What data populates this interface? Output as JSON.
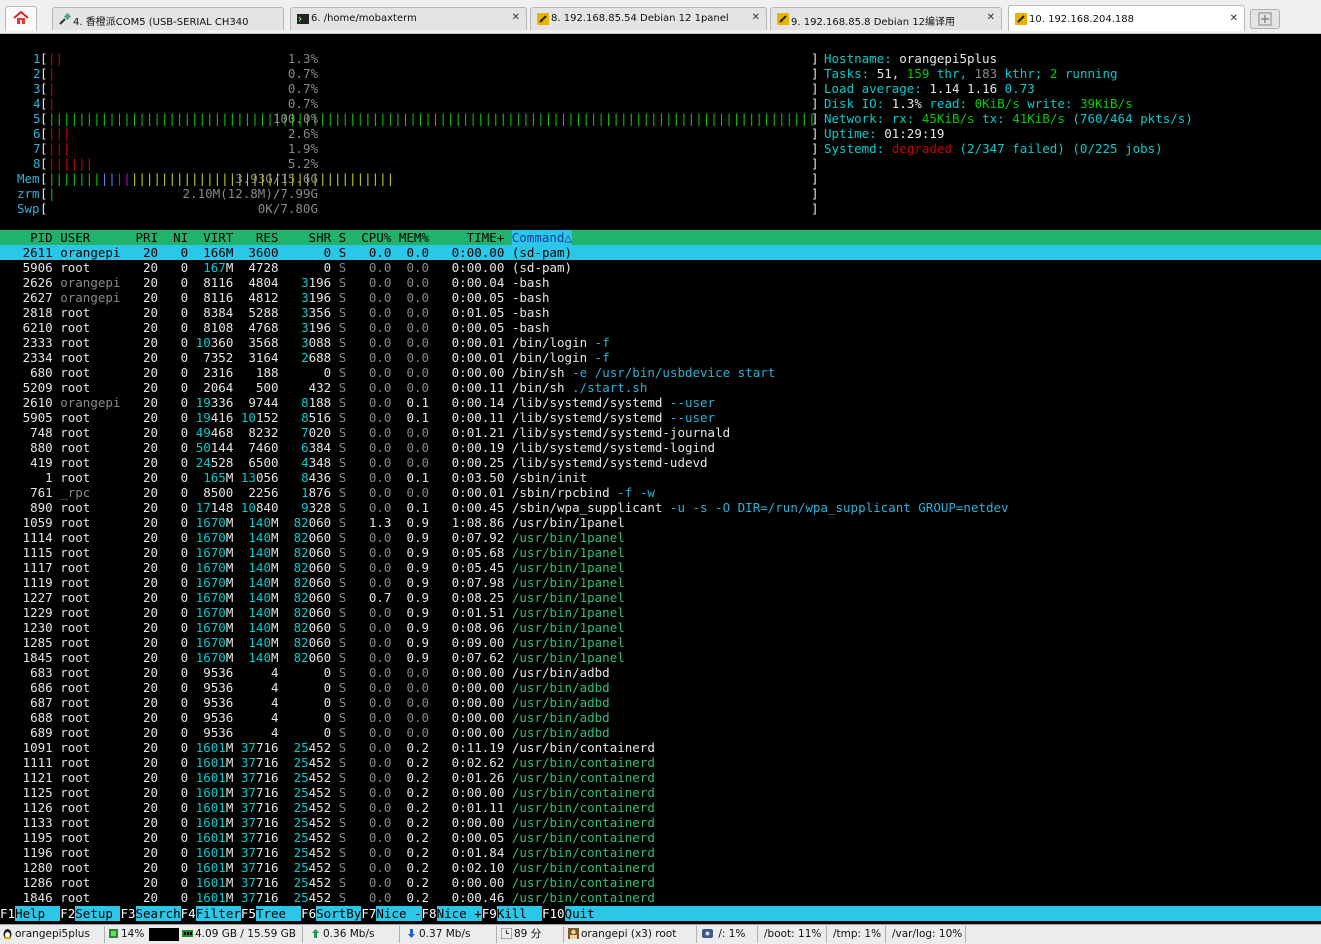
{
  "tabs": [
    {
      "label": "4. 香橙派COM5  (USB-SERIAL CH340",
      "close": "✕"
    },
    {
      "label": "6. /home/mobaxterm",
      "close": "✕"
    },
    {
      "label": "8. 192.168.85.54 Debian 12 1panel",
      "close": "✕"
    },
    {
      "label": "9. 192.168.85.8 Debian 12编译用",
      "close": "✕"
    },
    {
      "label": "10. 192.168.204.188",
      "close": "✕"
    }
  ],
  "cpu_meters": [
    {
      "label": "1",
      "bar": "||",
      "pct": "1.3%"
    },
    {
      "label": "2",
      "bar": "|",
      "pct": "0.7%"
    },
    {
      "label": "3",
      "bar": "|",
      "pct": "0.7%"
    },
    {
      "label": "4",
      "bar": "|",
      "pct": "0.7%"
    },
    {
      "label": "5",
      "bar": "||||||||||||||||||||||||||||||||||||||||||||||||||||||||||||||||||||||||||||||||||||||||||||||||||||||",
      "pct": "100.0%"
    },
    {
      "label": "6",
      "bar": "|||",
      "pct": "2.6%"
    },
    {
      "label": "7",
      "bar": "|||",
      "pct": "1.9%"
    },
    {
      "label": "8",
      "bar": "||||||",
      "pct": "5.2%"
    }
  ],
  "mem_meters": [
    {
      "label": "Mem",
      "value": "3.93G/15.6G"
    },
    {
      "label": "zrm",
      "value": "2.10M(12.8M)/7.99G"
    },
    {
      "label": "Swp",
      "value": "0K/7.80G"
    }
  ],
  "sysinfo": {
    "hostname_label": "Hostname:",
    "hostname": "orangepi5plus",
    "tasks_label": "Tasks:",
    "tasks": "51,",
    "thr": "159",
    "thr_label": "thr,",
    "kthr": "183",
    "kthr_label": "kthr;",
    "running": "2",
    "running_label": "running",
    "load_label": "Load average:",
    "load1": "1.14",
    "load5": "1.16",
    "load15": "0.73",
    "disk_label": "Disk IO:",
    "disk_pct": "1.3%",
    "disk_read_label": "read:",
    "disk_read": "0KiB/s",
    "disk_write_label": "write:",
    "disk_write": "39KiB/s",
    "net_label": "Network:",
    "net_rx_label": "rx:",
    "net_rx": "45KiB/s",
    "net_tx_label": "tx:",
    "net_tx": "41KiB/s",
    "net_pkts": "(760/464 pkts/s)",
    "uptime_label": "Uptime:",
    "uptime": "01:29:19",
    "systemd_label": "Systemd:",
    "systemd_state": "degraded",
    "systemd_failed": "(2/347 failed)",
    "systemd_jobs": "(0/225 jobs)"
  },
  "columns": [
    "PID",
    "USER",
    "PRI",
    "NI",
    "VIRT",
    "RES",
    "SHR",
    "S",
    "CPU%",
    "MEM%",
    "TIME+",
    "Command△"
  ],
  "processes": [
    {
      "pid": "2611",
      "user": "orangepi",
      "pri": "20",
      "ni": "0",
      "virt": "166M",
      "res": "3600",
      "shr": "0",
      "s": "S",
      "cpu": "0.0",
      "mem": "0.0",
      "time": "0:00.00",
      "cmd": "(sd-pam)",
      "args": ""
    },
    {
      "pid": "5906",
      "user": "root",
      "pri": "20",
      "ni": "0",
      "virt": "167M",
      "res": "4728",
      "shr": "0",
      "s": "S",
      "cpu": "0.0",
      "mem": "0.0",
      "time": "0:00.00",
      "cmd": "(sd-pam)",
      "args": ""
    },
    {
      "pid": "2626",
      "user": "orangepi",
      "pri": "20",
      "ni": "0",
      "virt": "8116",
      "res": "4804",
      "shr": "3196",
      "s": "S",
      "cpu": "0.0",
      "mem": "0.0",
      "time": "0:00.04",
      "cmd": "-bash",
      "args": ""
    },
    {
      "pid": "2627",
      "user": "orangepi",
      "pri": "20",
      "ni": "0",
      "virt": "8116",
      "res": "4812",
      "shr": "3196",
      "s": "S",
      "cpu": "0.0",
      "mem": "0.0",
      "time": "0:00.05",
      "cmd": "-bash",
      "args": ""
    },
    {
      "pid": "2818",
      "user": "root",
      "pri": "20",
      "ni": "0",
      "virt": "8384",
      "res": "5288",
      "shr": "3356",
      "s": "S",
      "cpu": "0.0",
      "mem": "0.0",
      "time": "0:01.05",
      "cmd": "-bash",
      "args": ""
    },
    {
      "pid": "6210",
      "user": "root",
      "pri": "20",
      "ni": "0",
      "virt": "8108",
      "res": "4768",
      "shr": "3196",
      "s": "S",
      "cpu": "0.0",
      "mem": "0.0",
      "time": "0:00.05",
      "cmd": "-bash",
      "args": ""
    },
    {
      "pid": "2333",
      "user": "root",
      "pri": "20",
      "ni": "0",
      "virt": "10360",
      "res": "3568",
      "shr": "3088",
      "s": "S",
      "cpu": "0.0",
      "mem": "0.0",
      "time": "0:00.01",
      "cmd": "/bin/login",
      "args": "-f"
    },
    {
      "pid": "2334",
      "user": "root",
      "pri": "20",
      "ni": "0",
      "virt": "7352",
      "res": "3164",
      "shr": "2688",
      "s": "S",
      "cpu": "0.0",
      "mem": "0.0",
      "time": "0:00.01",
      "cmd": "/bin/login",
      "args": "-f"
    },
    {
      "pid": "680",
      "user": "root",
      "pri": "20",
      "ni": "0",
      "virt": "2316",
      "res": "188",
      "shr": "0",
      "s": "S",
      "cpu": "0.0",
      "mem": "0.0",
      "time": "0:00.00",
      "cmd": "/bin/sh",
      "args": "-e /usr/bin/usbdevice start"
    },
    {
      "pid": "5209",
      "user": "root",
      "pri": "20",
      "ni": "0",
      "virt": "2064",
      "res": "500",
      "shr": "432",
      "s": "S",
      "cpu": "0.0",
      "mem": "0.0",
      "time": "0:00.11",
      "cmd": "/bin/sh",
      "args": "./start.sh"
    },
    {
      "pid": "2610",
      "user": "orangepi",
      "pri": "20",
      "ni": "0",
      "virt": "19336",
      "res": "9744",
      "shr": "8188",
      "s": "S",
      "cpu": "0.0",
      "mem": "0.1",
      "time": "0:00.14",
      "cmd": "/lib/systemd/systemd",
      "args": "--user"
    },
    {
      "pid": "5905",
      "user": "root",
      "pri": "20",
      "ni": "0",
      "virt": "19416",
      "res": "10152",
      "shr": "8516",
      "s": "S",
      "cpu": "0.0",
      "mem": "0.1",
      "time": "0:00.11",
      "cmd": "/lib/systemd/systemd",
      "args": "--user"
    },
    {
      "pid": "748",
      "user": "root",
      "pri": "20",
      "ni": "0",
      "virt": "49468",
      "res": "8232",
      "shr": "7020",
      "s": "S",
      "cpu": "0.0",
      "mem": "0.0",
      "time": "0:01.21",
      "cmd": "/lib/systemd/systemd-journald",
      "args": ""
    },
    {
      "pid": "880",
      "user": "root",
      "pri": "20",
      "ni": "0",
      "virt": "50144",
      "res": "7460",
      "shr": "6384",
      "s": "S",
      "cpu": "0.0",
      "mem": "0.0",
      "time": "0:00.19",
      "cmd": "/lib/systemd/systemd-logind",
      "args": ""
    },
    {
      "pid": "419",
      "user": "root",
      "pri": "20",
      "ni": "0",
      "virt": "24528",
      "res": "6500",
      "shr": "4348",
      "s": "S",
      "cpu": "0.0",
      "mem": "0.0",
      "time": "0:00.25",
      "cmd": "/lib/systemd/systemd-udevd",
      "args": ""
    },
    {
      "pid": "1",
      "user": "root",
      "pri": "20",
      "ni": "0",
      "virt": "165M",
      "res": "13056",
      "shr": "8436",
      "s": "S",
      "cpu": "0.0",
      "mem": "0.1",
      "time": "0:03.50",
      "cmd": "/sbin/init",
      "args": ""
    },
    {
      "pid": "761",
      "user": "_rpc",
      "pri": "20",
      "ni": "0",
      "virt": "8500",
      "res": "2256",
      "shr": "1876",
      "s": "S",
      "cpu": "0.0",
      "mem": "0.0",
      "time": "0:00.01",
      "cmd": "/sbin/rpcbind",
      "args": "-f -w"
    },
    {
      "pid": "890",
      "user": "root",
      "pri": "20",
      "ni": "0",
      "virt": "17148",
      "res": "10840",
      "shr": "9328",
      "s": "S",
      "cpu": "0.0",
      "mem": "0.1",
      "time": "0:00.45",
      "cmd": "/sbin/wpa_supplicant",
      "args": "-u -s -O DIR=/run/wpa_supplicant GROUP=netdev"
    },
    {
      "pid": "1059",
      "user": "root",
      "pri": "20",
      "ni": "0",
      "virt": "1670M",
      "res": "140M",
      "shr": "82060",
      "s": "S",
      "cpu": "1.3",
      "mem": "0.9",
      "time": "1:08.86",
      "cmd": "/usr/bin/1panel",
      "args": ""
    },
    {
      "pid": "1114",
      "user": "root",
      "pri": "20",
      "ni": "0",
      "virt": "1670M",
      "res": "140M",
      "shr": "82060",
      "s": "S",
      "cpu": "0.0",
      "mem": "0.9",
      "time": "0:07.92",
      "cmd": "/usr/bin/1panel",
      "args": "",
      "thread": true
    },
    {
      "pid": "1115",
      "user": "root",
      "pri": "20",
      "ni": "0",
      "virt": "1670M",
      "res": "140M",
      "shr": "82060",
      "s": "S",
      "cpu": "0.0",
      "mem": "0.9",
      "time": "0:05.68",
      "cmd": "/usr/bin/1panel",
      "args": "",
      "thread": true
    },
    {
      "pid": "1117",
      "user": "root",
      "pri": "20",
      "ni": "0",
      "virt": "1670M",
      "res": "140M",
      "shr": "82060",
      "s": "S",
      "cpu": "0.0",
      "mem": "0.9",
      "time": "0:05.45",
      "cmd": "/usr/bin/1panel",
      "args": "",
      "thread": true
    },
    {
      "pid": "1119",
      "user": "root",
      "pri": "20",
      "ni": "0",
      "virt": "1670M",
      "res": "140M",
      "shr": "82060",
      "s": "S",
      "cpu": "0.0",
      "mem": "0.9",
      "time": "0:07.98",
      "cmd": "/usr/bin/1panel",
      "args": "",
      "thread": true
    },
    {
      "pid": "1227",
      "user": "root",
      "pri": "20",
      "ni": "0",
      "virt": "1670M",
      "res": "140M",
      "shr": "82060",
      "s": "S",
      "cpu": "0.7",
      "mem": "0.9",
      "time": "0:08.25",
      "cmd": "/usr/bin/1panel",
      "args": "",
      "thread": true
    },
    {
      "pid": "1229",
      "user": "root",
      "pri": "20",
      "ni": "0",
      "virt": "1670M",
      "res": "140M",
      "shr": "82060",
      "s": "S",
      "cpu": "0.0",
      "mem": "0.9",
      "time": "0:01.51",
      "cmd": "/usr/bin/1panel",
      "args": "",
      "thread": true
    },
    {
      "pid": "1230",
      "user": "root",
      "pri": "20",
      "ni": "0",
      "virt": "1670M",
      "res": "140M",
      "shr": "82060",
      "s": "S",
      "cpu": "0.0",
      "mem": "0.9",
      "time": "0:08.96",
      "cmd": "/usr/bin/1panel",
      "args": "",
      "thread": true
    },
    {
      "pid": "1285",
      "user": "root",
      "pri": "20",
      "ni": "0",
      "virt": "1670M",
      "res": "140M",
      "shr": "82060",
      "s": "S",
      "cpu": "0.0",
      "mem": "0.9",
      "time": "0:09.00",
      "cmd": "/usr/bin/1panel",
      "args": "",
      "thread": true
    },
    {
      "pid": "1845",
      "user": "root",
      "pri": "20",
      "ni": "0",
      "virt": "1670M",
      "res": "140M",
      "shr": "82060",
      "s": "S",
      "cpu": "0.0",
      "mem": "0.9",
      "time": "0:07.62",
      "cmd": "/usr/bin/1panel",
      "args": "",
      "thread": true
    },
    {
      "pid": "683",
      "user": "root",
      "pri": "20",
      "ni": "0",
      "virt": "9536",
      "res": "4",
      "shr": "0",
      "s": "S",
      "cpu": "0.0",
      "mem": "0.0",
      "time": "0:00.00",
      "cmd": "/usr/bin/adbd",
      "args": ""
    },
    {
      "pid": "686",
      "user": "root",
      "pri": "20",
      "ni": "0",
      "virt": "9536",
      "res": "4",
      "shr": "0",
      "s": "S",
      "cpu": "0.0",
      "mem": "0.0",
      "time": "0:00.00",
      "cmd": "/usr/bin/adbd",
      "args": "",
      "thread": true
    },
    {
      "pid": "687",
      "user": "root",
      "pri": "20",
      "ni": "0",
      "virt": "9536",
      "res": "4",
      "shr": "0",
      "s": "S",
      "cpu": "0.0",
      "mem": "0.0",
      "time": "0:00.00",
      "cmd": "/usr/bin/adbd",
      "args": "",
      "thread": true
    },
    {
      "pid": "688",
      "user": "root",
      "pri": "20",
      "ni": "0",
      "virt": "9536",
      "res": "4",
      "shr": "0",
      "s": "S",
      "cpu": "0.0",
      "mem": "0.0",
      "time": "0:00.00",
      "cmd": "/usr/bin/adbd",
      "args": "",
      "thread": true
    },
    {
      "pid": "689",
      "user": "root",
      "pri": "20",
      "ni": "0",
      "virt": "9536",
      "res": "4",
      "shr": "0",
      "s": "S",
      "cpu": "0.0",
      "mem": "0.0",
      "time": "0:00.00",
      "cmd": "/usr/bin/adbd",
      "args": "",
      "thread": true
    },
    {
      "pid": "1091",
      "user": "root",
      "pri": "20",
      "ni": "0",
      "virt": "1601M",
      "res": "37716",
      "shr": "25452",
      "s": "S",
      "cpu": "0.0",
      "mem": "0.2",
      "time": "0:11.19",
      "cmd": "/usr/bin/containerd",
      "args": ""
    },
    {
      "pid": "1111",
      "user": "root",
      "pri": "20",
      "ni": "0",
      "virt": "1601M",
      "res": "37716",
      "shr": "25452",
      "s": "S",
      "cpu": "0.0",
      "mem": "0.2",
      "time": "0:02.62",
      "cmd": "/usr/bin/containerd",
      "args": "",
      "thread": true
    },
    {
      "pid": "1121",
      "user": "root",
      "pri": "20",
      "ni": "0",
      "virt": "1601M",
      "res": "37716",
      "shr": "25452",
      "s": "S",
      "cpu": "0.0",
      "mem": "0.2",
      "time": "0:01.26",
      "cmd": "/usr/bin/containerd",
      "args": "",
      "thread": true
    },
    {
      "pid": "1125",
      "user": "root",
      "pri": "20",
      "ni": "0",
      "virt": "1601M",
      "res": "37716",
      "shr": "25452",
      "s": "S",
      "cpu": "0.0",
      "mem": "0.2",
      "time": "0:00.00",
      "cmd": "/usr/bin/containerd",
      "args": "",
      "thread": true
    },
    {
      "pid": "1126",
      "user": "root",
      "pri": "20",
      "ni": "0",
      "virt": "1601M",
      "res": "37716",
      "shr": "25452",
      "s": "S",
      "cpu": "0.0",
      "mem": "0.2",
      "time": "0:01.11",
      "cmd": "/usr/bin/containerd",
      "args": "",
      "thread": true
    },
    {
      "pid": "1133",
      "user": "root",
      "pri": "20",
      "ni": "0",
      "virt": "1601M",
      "res": "37716",
      "shr": "25452",
      "s": "S",
      "cpu": "0.0",
      "mem": "0.2",
      "time": "0:00.00",
      "cmd": "/usr/bin/containerd",
      "args": "",
      "thread": true
    },
    {
      "pid": "1195",
      "user": "root",
      "pri": "20",
      "ni": "0",
      "virt": "1601M",
      "res": "37716",
      "shr": "25452",
      "s": "S",
      "cpu": "0.0",
      "mem": "0.2",
      "time": "0:00.05",
      "cmd": "/usr/bin/containerd",
      "args": "",
      "thread": true
    },
    {
      "pid": "1196",
      "user": "root",
      "pri": "20",
      "ni": "0",
      "virt": "1601M",
      "res": "37716",
      "shr": "25452",
      "s": "S",
      "cpu": "0.0",
      "mem": "0.2",
      "time": "0:01.84",
      "cmd": "/usr/bin/containerd",
      "args": "",
      "thread": true
    },
    {
      "pid": "1280",
      "user": "root",
      "pri": "20",
      "ni": "0",
      "virt": "1601M",
      "res": "37716",
      "shr": "25452",
      "s": "S",
      "cpu": "0.0",
      "mem": "0.2",
      "time": "0:02.10",
      "cmd": "/usr/bin/containerd",
      "args": "",
      "thread": true
    },
    {
      "pid": "1286",
      "user": "root",
      "pri": "20",
      "ni": "0",
      "virt": "1601M",
      "res": "37716",
      "shr": "25452",
      "s": "S",
      "cpu": "0.0",
      "mem": "0.2",
      "time": "0:00.00",
      "cmd": "/usr/bin/containerd",
      "args": "",
      "thread": true
    },
    {
      "pid": "1846",
      "user": "root",
      "pri": "20",
      "ni": "0",
      "virt": "1601M",
      "res": "37716",
      "shr": "25452",
      "s": "S",
      "cpu": "0.0",
      "mem": "0.2",
      "time": "0:00.46",
      "cmd": "/usr/bin/containerd",
      "args": "",
      "thread": true
    }
  ],
  "function_keys": [
    {
      "key": "F1",
      "label": "Help  "
    },
    {
      "key": "F2",
      "label": "Setup "
    },
    {
      "key": "F3",
      "label": "Search"
    },
    {
      "key": "F4",
      "label": "Filter"
    },
    {
      "key": "F5",
      "label": "Tree  "
    },
    {
      "key": "F6",
      "label": "SortBy"
    },
    {
      "key": "F7",
      "label": "Nice -"
    },
    {
      "key": "F8",
      "label": "Nice +"
    },
    {
      "key": "F9",
      "label": "Kill  "
    },
    {
      "key": "F10",
      "label": "Quit  "
    }
  ],
  "statusbar": {
    "host": "orangepi5plus",
    "cpu": "14%",
    "mem": "4.09 GB / 15.59 GB",
    "upload": "0.36 Mb/s",
    "download": "0.37 Mb/s",
    "time": "89 分",
    "user": "orangepi (x3)  root",
    "disk_root": "/: 1%",
    "disk_boot": "/boot: 11%",
    "disk_tmp": "/tmp: 1%",
    "disk_varlog": "/var/log: 10%"
  },
  "colors": {
    "header_bg": "#21b36c",
    "selection_bg": "#2bc7e8",
    "cyan": "#00cdcd",
    "green": "#00cd00",
    "red": "#cd0000"
  }
}
